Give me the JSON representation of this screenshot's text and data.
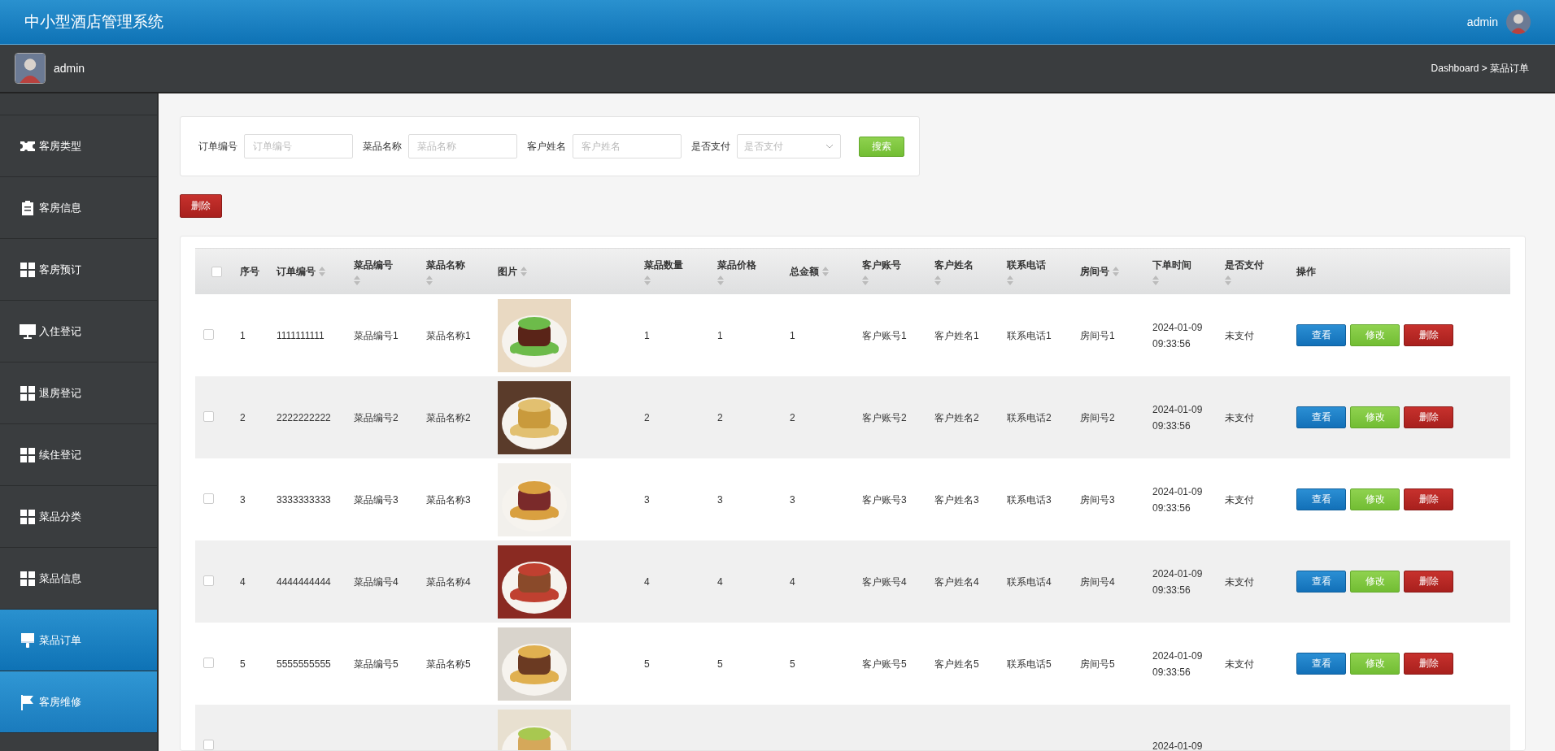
{
  "header": {
    "title": "中小型酒店管理系统",
    "user": "admin"
  },
  "subheader": {
    "user": "admin",
    "breadcrumb": [
      {
        "label": "Dashboard"
      },
      {
        "label": "菜品订单"
      }
    ],
    "separator": ">"
  },
  "sidebar": {
    "items": [
      {
        "label": "客房类型",
        "kind": "ticket",
        "selected": false,
        "hover": false
      },
      {
        "label": "客房信息",
        "kind": "clipboard",
        "selected": false,
        "hover": false
      },
      {
        "label": "客房预订",
        "kind": "grid",
        "selected": false,
        "hover": false
      },
      {
        "label": "入住登记",
        "kind": "monitor",
        "selected": false,
        "hover": false
      },
      {
        "label": "退房登记",
        "kind": "grid",
        "selected": false,
        "hover": false
      },
      {
        "label": "续住登记",
        "kind": "grid",
        "selected": false,
        "hover": false
      },
      {
        "label": "菜品分类",
        "kind": "grid",
        "selected": false,
        "hover": false
      },
      {
        "label": "菜品信息",
        "kind": "grid",
        "selected": false,
        "hover": false
      },
      {
        "label": "菜品订单",
        "kind": "brush",
        "selected": true,
        "hover": false
      },
      {
        "label": "客房维修",
        "kind": "flag",
        "selected": false,
        "hover": true
      }
    ]
  },
  "search": {
    "fields": [
      {
        "label": "订单编号",
        "placeholder": "订单编号",
        "kind": "input"
      },
      {
        "label": "菜品名称",
        "placeholder": "菜品名称",
        "kind": "input"
      },
      {
        "label": "客户姓名",
        "placeholder": "客户姓名",
        "kind": "input"
      },
      {
        "label": "是否支付",
        "placeholder": "是否支付",
        "kind": "select"
      }
    ],
    "button": "搜索"
  },
  "delete_button": "删除",
  "table": {
    "all_checked": false,
    "columns": [
      {
        "label": "序号",
        "kind": "plain"
      },
      {
        "label": "订单编号",
        "kind": "sort-inline"
      },
      {
        "label": "菜品编号",
        "kind": "sort-below"
      },
      {
        "label": "菜品名称",
        "kind": "sort-below"
      },
      {
        "label": "图片",
        "kind": "sort-inline"
      },
      {
        "label": "菜品数量",
        "kind": "sort-below"
      },
      {
        "label": "菜品价格",
        "kind": "sort-below"
      },
      {
        "label": "总金额",
        "kind": "sort-inline"
      },
      {
        "label": "客户账号",
        "kind": "sort-below"
      },
      {
        "label": "客户姓名",
        "kind": "sort-below"
      },
      {
        "label": "联系电话",
        "kind": "sort-below"
      },
      {
        "label": "房间号",
        "kind": "sort-inline"
      },
      {
        "label": "下单时间",
        "kind": "sort-below"
      },
      {
        "label": "是否支付",
        "kind": "sort-below"
      },
      {
        "label": "操作",
        "kind": "plain"
      }
    ],
    "rows": [
      {
        "checked": false,
        "cells": [
          "1",
          "1111111111",
          "菜品编号1",
          "菜品名称1",
          {
            "kind": "picture"
          },
          "1",
          "1",
          "1",
          "客户账号1",
          "客户姓名1",
          "联系电话1",
          "房间号1",
          [
            "2024-01-09",
            "09:33:56"
          ],
          "未支付"
        ],
        "actions": [
          "查看",
          "修改",
          "删除"
        ]
      },
      {
        "checked": false,
        "cells": [
          "2",
          "2222222222",
          "菜品编号2",
          "菜品名称2",
          {
            "kind": "picture"
          },
          "2",
          "2",
          "2",
          "客户账号2",
          "客户姓名2",
          "联系电话2",
          "房间号2",
          [
            "2024-01-09",
            "09:33:56"
          ],
          "未支付"
        ],
        "actions": [
          "查看",
          "修改",
          "删除"
        ]
      },
      {
        "checked": false,
        "cells": [
          "3",
          "3333333333",
          "菜品编号3",
          "菜品名称3",
          {
            "kind": "picture"
          },
          "3",
          "3",
          "3",
          "客户账号3",
          "客户姓名3",
          "联系电话3",
          "房间号3",
          [
            "2024-01-09",
            "09:33:56"
          ],
          "未支付"
        ],
        "actions": [
          "查看",
          "修改",
          "删除"
        ]
      },
      {
        "checked": false,
        "cells": [
          "4",
          "4444444444",
          "菜品编号4",
          "菜品名称4",
          {
            "kind": "picture"
          },
          "4",
          "4",
          "4",
          "客户账号4",
          "客户姓名4",
          "联系电话4",
          "房间号4",
          [
            "2024-01-09",
            "09:33:56"
          ],
          "未支付"
        ],
        "actions": [
          "查看",
          "修改",
          "删除"
        ]
      },
      {
        "checked": false,
        "cells": [
          "5",
          "5555555555",
          "菜品编号5",
          "菜品名称5",
          {
            "kind": "picture"
          },
          "5",
          "5",
          "5",
          "客户账号5",
          "客户姓名5",
          "联系电话5",
          "房间号5",
          [
            "2024-01-09",
            "09:33:56"
          ],
          "未支付"
        ],
        "actions": [
          "查看",
          "修改",
          "删除"
        ]
      },
      {
        "checked": false,
        "cells": [
          "",
          "",
          "",
          "",
          {
            "kind": "picture"
          },
          "",
          "",
          "",
          "",
          "",
          "",
          "",
          [
            "2024-01-09"
          ],
          ""
        ],
        "actions": []
      }
    ]
  }
}
